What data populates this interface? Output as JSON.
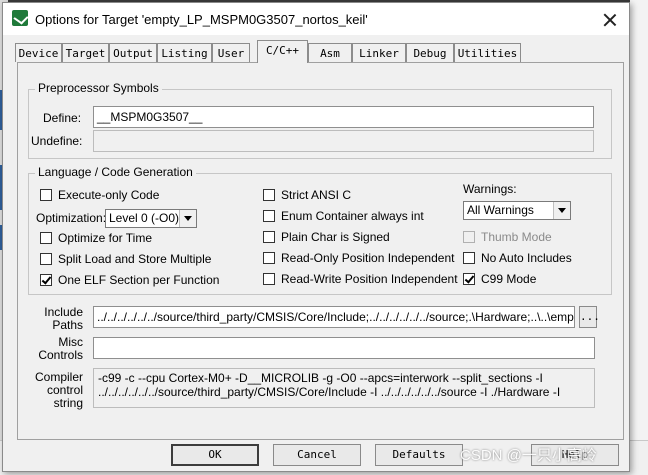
{
  "window": {
    "title": "Options for Target 'empty_LP_MSPM0G3507_nortos_keil'"
  },
  "tabs": [
    "Device",
    "Target",
    "Output",
    "Listing",
    "User",
    "C/C++",
    "Asm",
    "Linker",
    "Debug",
    "Utilities"
  ],
  "active_tab": "C/C++",
  "preprocessor": {
    "group_label": "Preprocessor Symbols",
    "define_label": "Define:",
    "define_value": "__MSPM0G3507__",
    "undefine_label": "Undefine:",
    "undefine_value": ""
  },
  "codegen": {
    "group_label": "Language / Code Generation",
    "execute_only": {
      "label": "Execute-only Code",
      "checked": false
    },
    "optimization_label": "Optimization:",
    "optimization_value": "Level 0 (-O0)",
    "optimize_for_time": {
      "label": "Optimize for Time",
      "checked": false
    },
    "split_load_store": {
      "label": "Split Load and Store Multiple",
      "checked": false
    },
    "one_elf_section": {
      "label": "One ELF Section per Function",
      "checked": true
    },
    "strict_ansi": {
      "label": "Strict ANSI C",
      "checked": false
    },
    "enum_container": {
      "label": "Enum Container always int",
      "checked": false
    },
    "plain_char_signed": {
      "label": "Plain Char is Signed",
      "checked": false
    },
    "ro_position_independent": {
      "label": "Read-Only Position Independent",
      "checked": false
    },
    "rw_position_independent": {
      "label": "Read-Write Position Independent",
      "checked": false
    },
    "warnings_label": "Warnings:",
    "warnings_value": "All Warnings",
    "thumb_mode": {
      "label": "Thumb Mode",
      "checked": false,
      "disabled": true
    },
    "no_auto_includes": {
      "label": "No Auto Includes",
      "checked": false
    },
    "c99_mode": {
      "label": "C99 Mode",
      "checked": true
    }
  },
  "include_paths": {
    "label_line1": "Include",
    "label_line2": "Paths",
    "value": "../../../../../../source/third_party/CMSIS/Core/Include;../../../../../../source;.\\Hardware;..\\..\\empty -",
    "browse_label": "..."
  },
  "misc_controls": {
    "label_line1": "Misc",
    "label_line2": "Controls",
    "value": ""
  },
  "compiler_control": {
    "label_line1": "Compiler",
    "label_line2": "control",
    "label_line3": "string",
    "line1": "-c99 -c --cpu Cortex-M0+ -D__MICROLIB -g -O0 --apcs=interwork --split_sections -I",
    "line2": "../../../../../../source/third_party/CMSIS/Core/Include -I ../../../../../../source -I ./Hardware -I"
  },
  "buttons": {
    "ok": "OK",
    "cancel": "Cancel",
    "defaults": "Defaults",
    "help": "Help"
  },
  "watermark": "CSDN @一只小高岭"
}
